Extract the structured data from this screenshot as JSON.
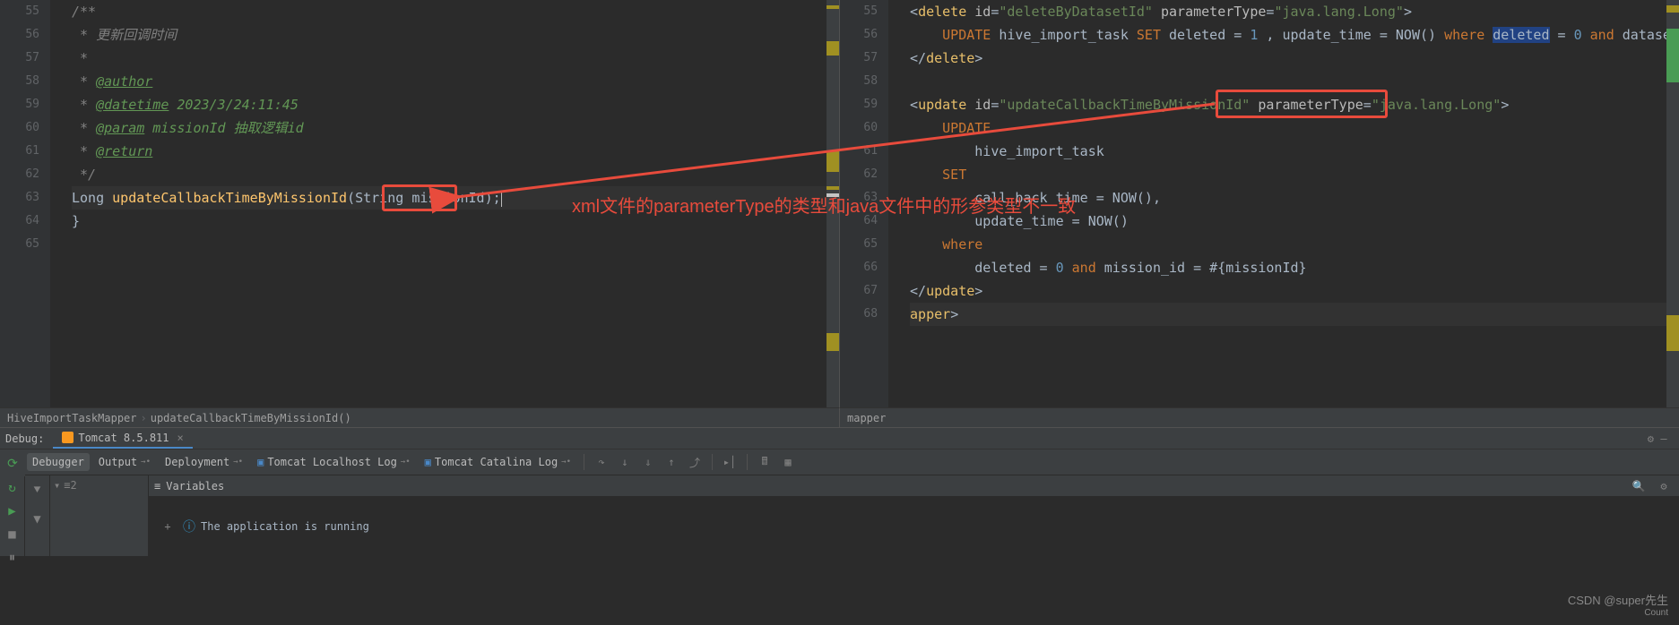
{
  "left_pane": {
    "lines": [
      {
        "n": 55,
        "html": "<span class='c-comment'>/**</span>"
      },
      {
        "n": 56,
        "html": "<span class='c-comment'> * 更新回调时间</span>"
      },
      {
        "n": 57,
        "html": "<span class='c-comment'> *</span>"
      },
      {
        "n": 58,
        "html": "<span class='c-comment'> * </span><span class='c-tag'>@author</span>"
      },
      {
        "n": 59,
        "html": "<span class='c-comment'> * </span><span class='c-tag'>@datetime</span><span class='c-comment-g'> 2023/3/24:11:45</span>"
      },
      {
        "n": 60,
        "html": "<span class='c-comment'> * </span><span class='c-tag'>@param</span><span class='c-comment-g'> missionId 抽取逻辑id</span>"
      },
      {
        "n": 61,
        "html": "<span class='c-comment'> * </span><span class='c-tag'>@return</span>"
      },
      {
        "n": 62,
        "html": "<span class='c-comment'> */</span>"
      },
      {
        "n": 63,
        "hl": true,
        "html": "<span class='c-type'>Long </span><span class='c-method'>updateCallbackTimeByMissionId</span><span class='c-punct'>(</span><span class='c-type'>String </span><span class='c-param'>missionId</span><span class='c-punct'>);</span><span class='caret'></span>"
      },
      {
        "n": 64,
        "html": "<span class='c-punct'>}</span>"
      },
      {
        "n": 65,
        "html": ""
      }
    ],
    "breadcrumb": {
      "item1": "HiveImportTaskMapper",
      "item2": "updateCallbackTimeByMissionId()"
    }
  },
  "right_pane": {
    "lines": [
      {
        "n": 55,
        "html": "<span class='c-punct'>&lt;</span><span class='c-el'>delete </span><span class='c-attr'>id</span><span class='c-punct'>=</span><span class='c-str'>\"deleteByDatasetId\"</span> <span class='c-attr'>parameterType</span><span class='c-punct'>=</span><span class='c-str'>\"java.lang.Long\"</span><span class='c-punct'>&gt;</span>"
      },
      {
        "n": 56,
        "html": "    <span class='c-sql-kw'>UPDATE</span> <span class='c-sql-id'>hive_import_task</span> <span class='c-sql-kw'>SET</span> <span class='c-sql-id'>deleted</span> = <span class='c-num'>1</span> , <span class='c-sql-id'>update_time</span> = NOW() <span class='c-sql-kw'>where</span> <span class='selbg'>deleted</span> = <span class='c-num'>0</span> <span class='c-sql-kw'>and</span> <span class='c-sql-id'>dataset</span>"
      },
      {
        "n": 57,
        "html": "<span class='c-punct'>&lt;/</span><span class='c-el'>delete</span><span class='c-punct'>&gt;</span>"
      },
      {
        "n": 58,
        "html": ""
      },
      {
        "n": 59,
        "html": "<span class='c-punct'>&lt;</span><span class='c-el'>update </span><span class='c-attr'>id</span><span class='c-punct'>=</span><span class='c-str'>\"updateCallbackTimeByMissionId\"</span> <span class='c-attr'>parameterType</span><span class='c-punct'>=</span><span class='c-str'>\"java.lang.Long\"</span><span class='c-punct'>&gt;</span>"
      },
      {
        "n": 60,
        "html": "    <span class='c-sql-kw'>UPDATE</span>"
      },
      {
        "n": 61,
        "html": "        <span class='c-sql-id'>hive_import_task</span>"
      },
      {
        "n": 62,
        "html": "    <span class='c-sql-kw'>SET</span>"
      },
      {
        "n": 63,
        "html": "        <span class='c-sql-id'>call_back_time</span> = NOW(),"
      },
      {
        "n": 64,
        "html": "        <span class='c-sql-id'>update_time</span> = NOW()"
      },
      {
        "n": 65,
        "html": "    <span class='c-sql-kw'>where</span>"
      },
      {
        "n": 66,
        "html": "        <span class='c-sql-id'>deleted</span> = <span class='c-num'>0</span> <span class='c-sql-kw'>and</span> <span class='c-sql-id'>mission_id</span> = #{missionId}"
      },
      {
        "n": 67,
        "html": "<span class='c-punct'>&lt;/</span><span class='c-el'>update</span><span class='c-punct'>&gt;</span>"
      },
      {
        "n": 68,
        "hl": true,
        "html": "<span class='c-el'>apper</span><span class='c-punct'>&gt;</span>"
      }
    ],
    "breadcrumb": {
      "item1": "mapper"
    }
  },
  "annotation_text": "xml文件的parameterType的类型和java文件中的形参类型不一致",
  "tabbar": {
    "label": "Debug:",
    "tab": "Tomcat 8.5.811"
  },
  "debug_tabs": {
    "debugger": "Debugger",
    "output": "Output",
    "deployment": "Deployment",
    "localhost_log": "Tomcat Localhost Log",
    "catalina_log": "Tomcat Catalina Log"
  },
  "frames": {
    "threads": "≡2"
  },
  "variables": {
    "header": "Variables",
    "status": "The application is running"
  },
  "watermark": {
    "main": "CSDN @super先生",
    "sub": "Count"
  }
}
